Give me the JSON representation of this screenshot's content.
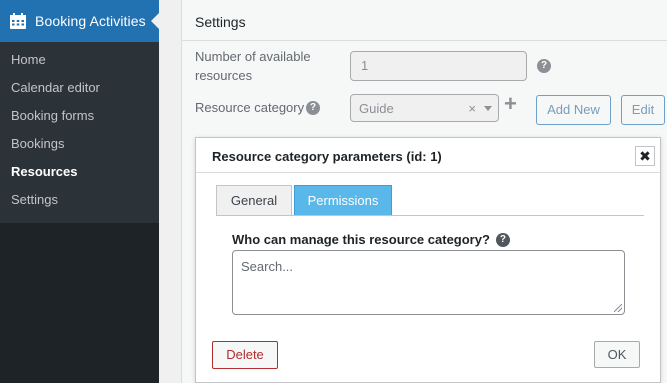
{
  "sidebar": {
    "plugin_title": "Booking Activities",
    "plugin_icon": "calendar-icon",
    "items": [
      {
        "label": "Home",
        "active": false
      },
      {
        "label": "Calendar editor",
        "active": false
      },
      {
        "label": "Booking forms",
        "active": false
      },
      {
        "label": "Bookings",
        "active": false
      },
      {
        "label": "Resources",
        "active": true
      },
      {
        "label": "Settings",
        "active": false
      }
    ]
  },
  "settings": {
    "title": "Settings",
    "available_resources_label": "Number of available resources",
    "available_resources_label_line1": "Number of available",
    "available_resources_label_line2": "resources",
    "available_resources_value": "1",
    "resource_category_label": "Resource category",
    "resource_category_value": "Guide",
    "clear_symbol": "×",
    "add_symbol": "+",
    "add_new_label": "Add New",
    "edit_label": "Edit",
    "help_symbol": "?"
  },
  "dialog": {
    "title": "Resource category parameters (id: 1)",
    "close_symbol": "✖",
    "tabs": [
      {
        "label": "General",
        "active": false
      },
      {
        "label": "Permissions",
        "active": true
      }
    ],
    "field_label": "Who can manage this resource category?",
    "search_placeholder": "Search...",
    "delete_label": "Delete",
    "ok_label": "OK"
  },
  "colors": {
    "accent": "#2271b1",
    "sidebar_bg": "#1d2327",
    "active_tab": "#5ab7ea",
    "danger": "#b32d2e"
  }
}
